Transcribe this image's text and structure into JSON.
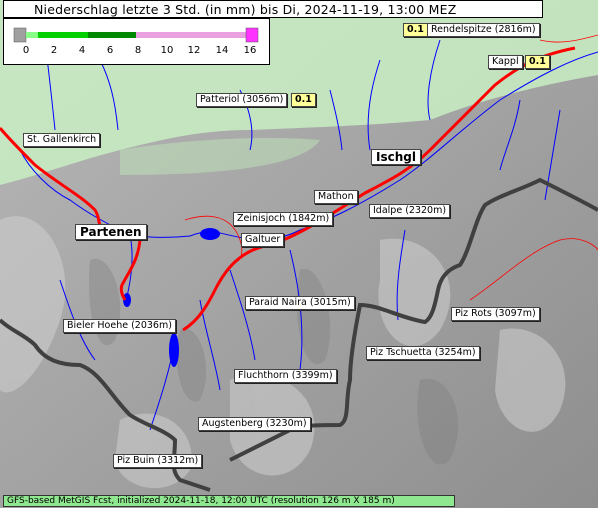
{
  "title": "Niederschlag letzte 3 Std. (in mm) bis Di, 2024-11-19, 13:00 MEZ",
  "legend": {
    "ticks": [
      "0",
      "2",
      "4",
      "6",
      "8",
      "10",
      "12",
      "14",
      "16"
    ],
    "colors": [
      "#a0a0a0",
      "#00e000",
      "#00b000",
      "#008000",
      "#ee99dd",
      "#ff44ff"
    ]
  },
  "places": [
    {
      "name": "Rendelspitze (2816m)",
      "value": "0.1"
    },
    {
      "name": "Kappl",
      "value": "0.1"
    },
    {
      "name": "Patteriol (3056m)",
      "value": "0.1"
    },
    {
      "name": "St. Gallenkirch"
    },
    {
      "name": "Ischgl"
    },
    {
      "name": "Mathon"
    },
    {
      "name": "Zeinisjoch (1842m)"
    },
    {
      "name": "Idalpe (2320m)"
    },
    {
      "name": "Partenen"
    },
    {
      "name": "Galtuer"
    },
    {
      "name": "Paraid Naira (3015m)"
    },
    {
      "name": "Piz Rots (3097m)"
    },
    {
      "name": "Bieler Hoehe (2036m)"
    },
    {
      "name": "Piz Tschuetta (3254m)"
    },
    {
      "name": "Fluchthorn (3399m)"
    },
    {
      "name": "Augstenberg (3230m)"
    },
    {
      "name": "Piz Buin (3312m)"
    }
  ],
  "footer": "GFS-based MetGIS Fcst, initialized 2024-11-18, 12:00 UTC  (resolution 126 m X 185 m)",
  "colors": {
    "precip_light": "#c8f0c0",
    "border": "#404040",
    "road": "#ff0000",
    "river": "#0000ff"
  }
}
